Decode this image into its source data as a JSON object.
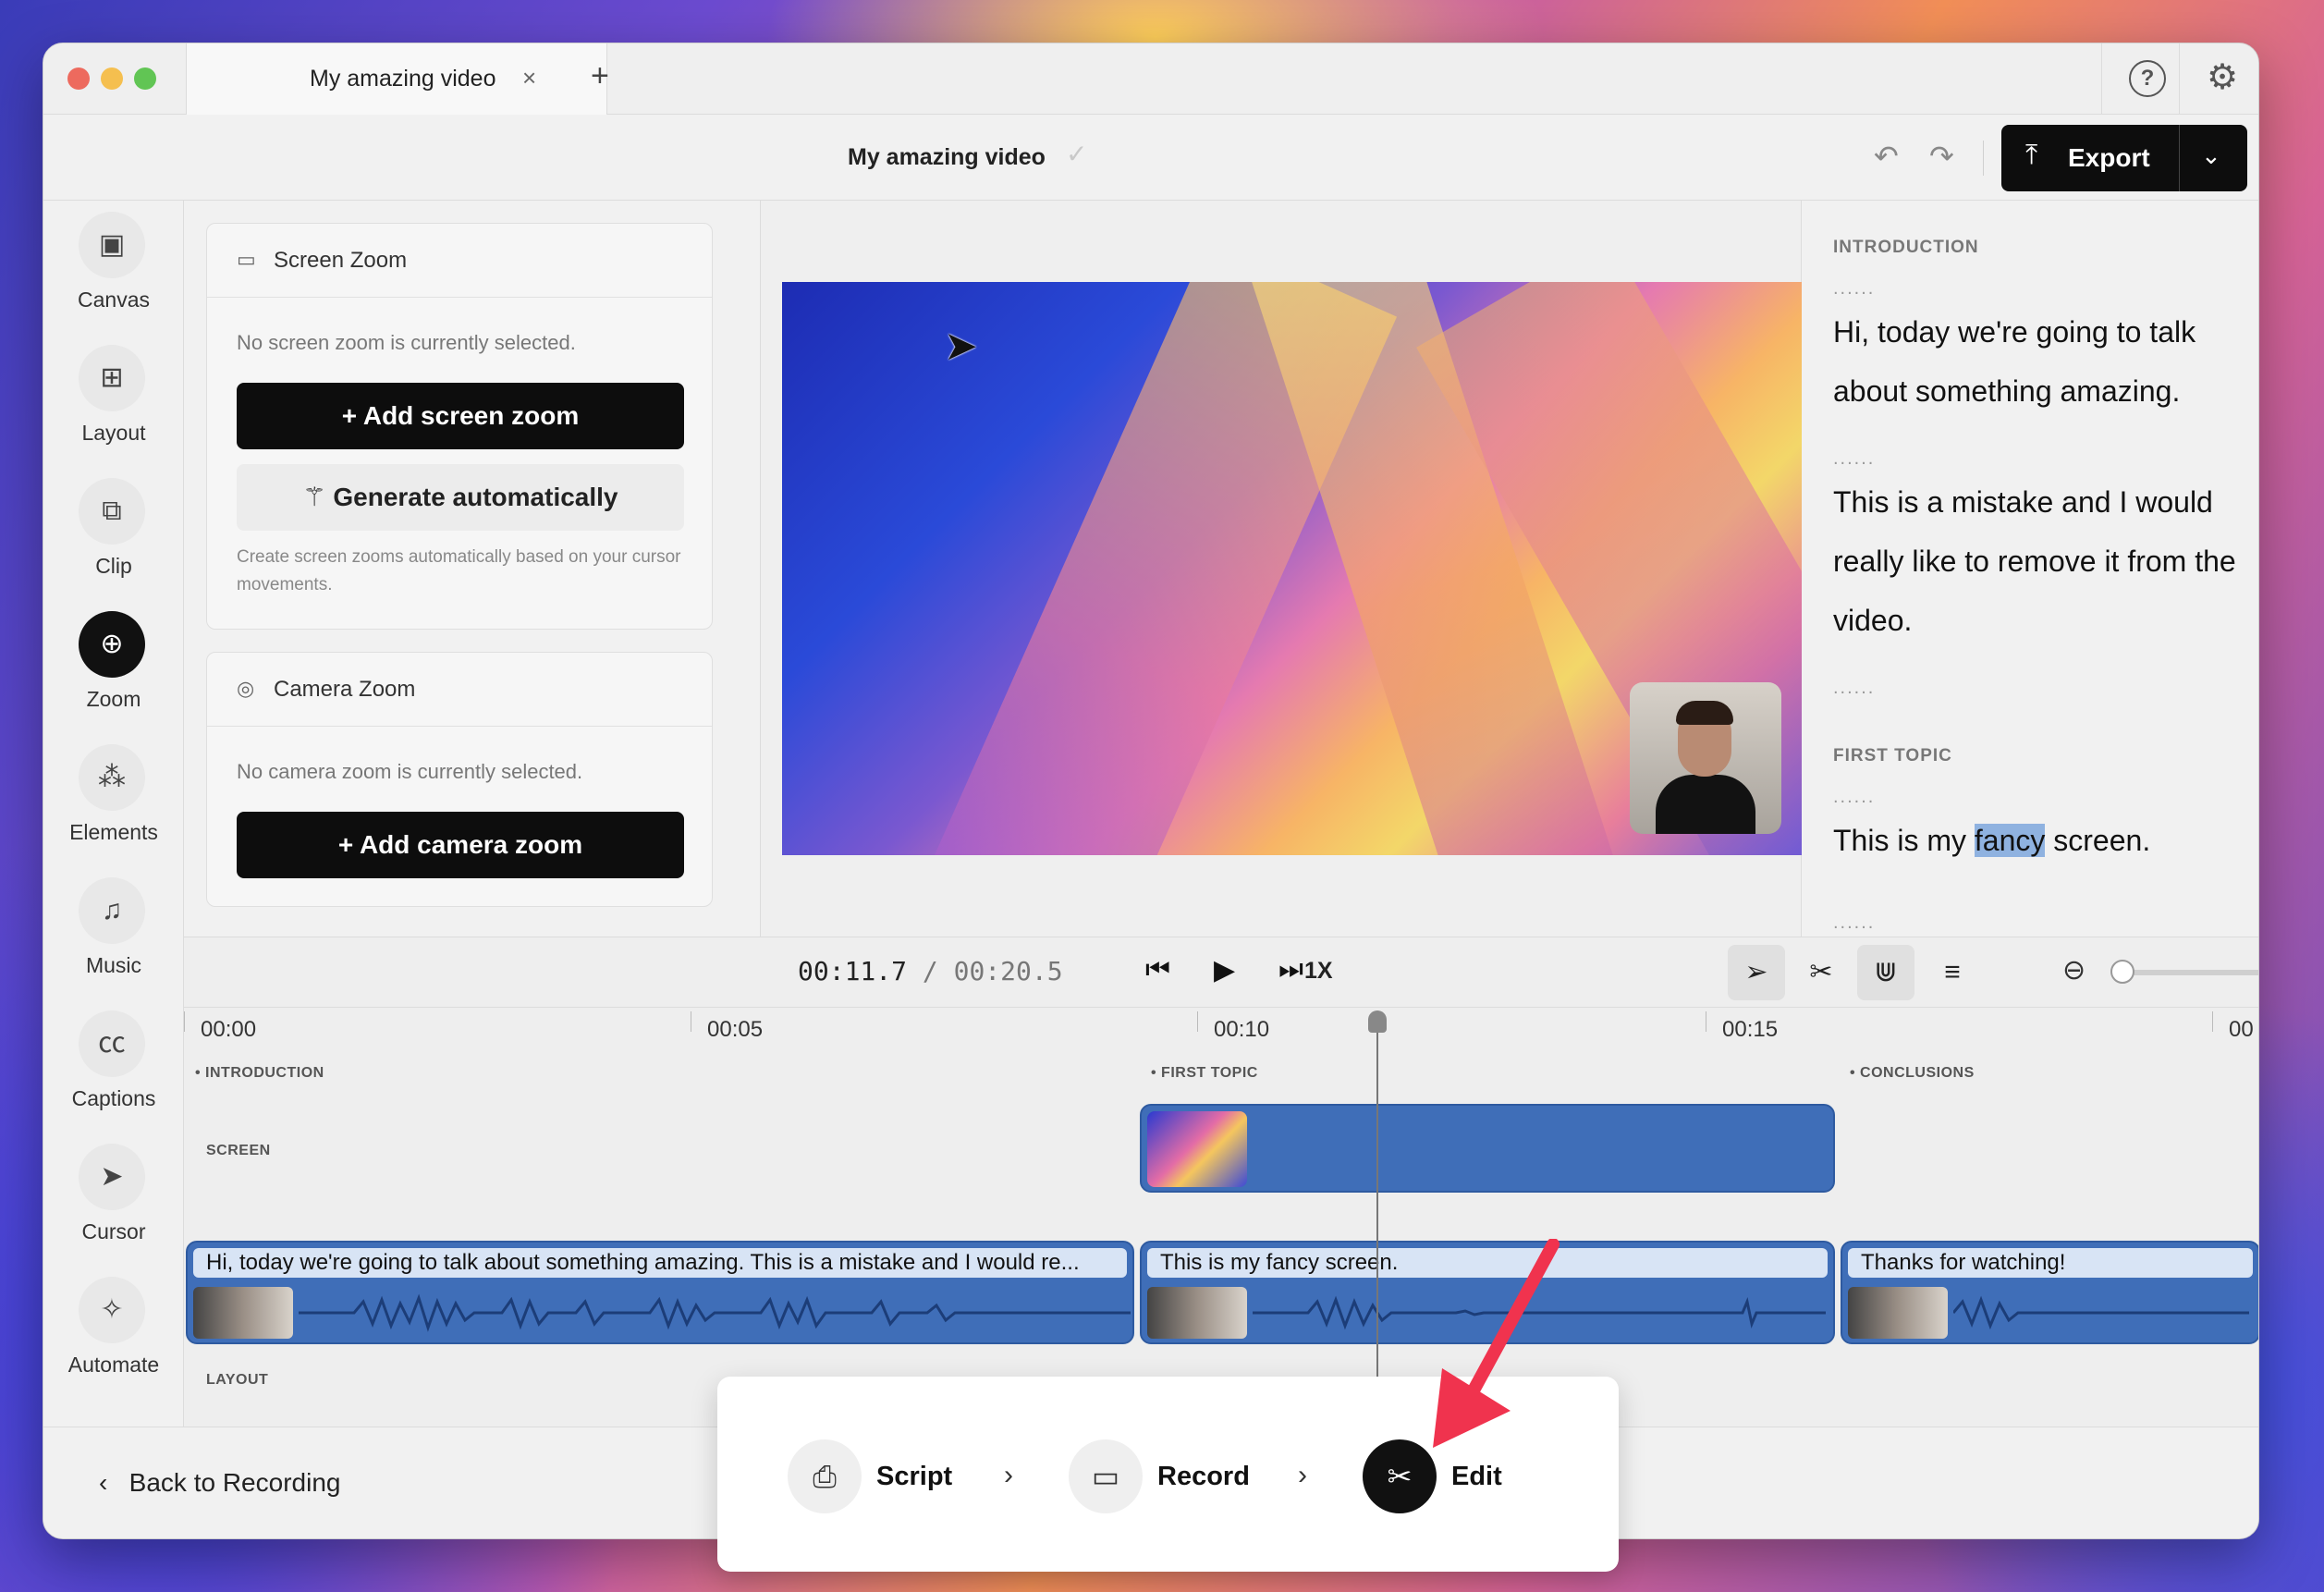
{
  "tab": {
    "title": "My amazing video",
    "close": "×",
    "new": "+"
  },
  "header": {
    "project_title": "My amazing video",
    "export_label": "Export"
  },
  "rail": {
    "items": [
      {
        "label": "Canvas",
        "icon": "canvas-icon",
        "glyph": "▣"
      },
      {
        "label": "Layout",
        "icon": "layout-icon",
        "glyph": "⊞"
      },
      {
        "label": "Clip",
        "icon": "clip-icon",
        "glyph": "⧉"
      },
      {
        "label": "Zoom",
        "icon": "zoom-icon",
        "glyph": "⊕",
        "active": true
      },
      {
        "label": "Elements",
        "icon": "elements-icon",
        "glyph": "⁂"
      },
      {
        "label": "Music",
        "icon": "music-icon",
        "glyph": "♫"
      },
      {
        "label": "Captions",
        "icon": "captions-icon",
        "glyph": "㏄"
      },
      {
        "label": "Cursor",
        "icon": "cursor-icon",
        "glyph": "➤"
      },
      {
        "label": "Automate",
        "icon": "automate-icon",
        "glyph": "✧"
      }
    ]
  },
  "zoom_panel": {
    "screen": {
      "title": "Screen Zoom",
      "empty": "No screen zoom is currently selected.",
      "add_label": "+  Add screen zoom",
      "generate_label": "Generate automatically",
      "help": "Create screen zooms automatically based on your cursor movements."
    },
    "camera": {
      "title": "Camera Zoom",
      "empty": "No camera zoom is currently selected.",
      "add_label": "+  Add camera zoom"
    }
  },
  "script": {
    "dots": "......",
    "sections": [
      {
        "heading": "INTRODUCTION"
      },
      {
        "heading": "FIRST TOPIC"
      }
    ],
    "para1": "Hi, today we're going to talk about something amazing.",
    "para2": "This is a mistake and I would really like to remove it from the video.",
    "para3_before": "This is my ",
    "para3_highlight": "fancy",
    "para3_after": " screen."
  },
  "player": {
    "current": "00:11.7",
    "separator": "/",
    "total": "00:20.5",
    "speed": "1X"
  },
  "timeline": {
    "ruler": [
      "00:00",
      "00:05",
      "00:10",
      "00:15",
      "00"
    ],
    "chapters": [
      "INTRODUCTION",
      "FIRST TOPIC",
      "CONCLUSIONS"
    ],
    "tracks": {
      "screen": "SCREEN",
      "layout": "LAYOUT"
    },
    "clips": [
      "Hi, today we're going to talk about something amazing. This is a mistake and I would re...",
      "This is my fancy screen.",
      "Thanks for watching!"
    ]
  },
  "footer": {
    "back_label": "Back to Recording"
  },
  "steps": [
    {
      "label": "Script",
      "icon": "script-icon"
    },
    {
      "label": "Record",
      "icon": "record-icon"
    },
    {
      "label": "Edit",
      "icon": "scissors-icon",
      "active": true
    }
  ],
  "colors": {
    "accent": "#3f6eb8",
    "annotation_arrow": "#f0334e",
    "button": "#0d0d0d"
  }
}
